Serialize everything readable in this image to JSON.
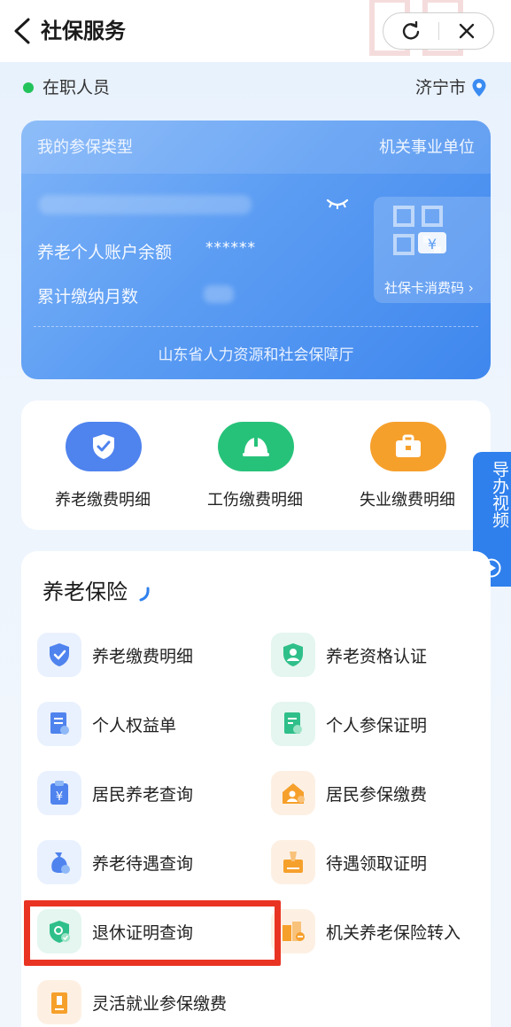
{
  "nav": {
    "title": "社保服务",
    "back_icon": "back-icon",
    "refresh_icon": "refresh-icon",
    "close_icon": "close-icon"
  },
  "status": {
    "employment": "在职人员",
    "city": "济宁市"
  },
  "card": {
    "type_label": "我的参保类型",
    "type_value": "机关事业单位",
    "balance_label": "养老个人账户余额",
    "balance_value": "******",
    "months_label": "累计缴纳月数",
    "qr_label": "社保卡消费码 ›",
    "footer": "山东省人力资源和社会保障厅",
    "colors": {
      "card_start": "#7fb4f8",
      "card_end": "#3f87ee"
    }
  },
  "quick": [
    {
      "label": "养老缴费明细",
      "icon": "shield-icon",
      "color": "#4f83ee"
    },
    {
      "label": "工伤缴费明细",
      "icon": "helmet-icon",
      "color": "#27c27a"
    },
    {
      "label": "失业缴费明细",
      "icon": "briefcase-icon",
      "color": "#f6a02c"
    }
  ],
  "side_tab": {
    "label": "导办视频",
    "icon": "play-icon"
  },
  "pension": {
    "title": "养老保险",
    "items": [
      {
        "label": "养老缴费明细",
        "icon": "shield-check-icon",
        "tone": "blue"
      },
      {
        "label": "养老资格认证",
        "icon": "user-verify-icon",
        "tone": "green"
      },
      {
        "label": "个人权益单",
        "icon": "document-icon",
        "tone": "blue"
      },
      {
        "label": "个人参保证明",
        "icon": "certificate-icon",
        "tone": "green"
      },
      {
        "label": "居民养老查询",
        "icon": "yuan-clipboard-icon",
        "tone": "blue"
      },
      {
        "label": "居民参保缴费",
        "icon": "house-user-icon",
        "tone": "orange"
      },
      {
        "label": "养老待遇查询",
        "icon": "money-bag-icon",
        "tone": "blue"
      },
      {
        "label": "待遇领取证明",
        "icon": "sign-document-icon",
        "tone": "orange"
      },
      {
        "label": "退休证明查询",
        "icon": "retire-check-icon",
        "tone": "green"
      },
      {
        "label": "机关养老保险转入",
        "icon": "building-transfer-icon",
        "tone": "orange"
      },
      {
        "label": "灵活就业参保缴费",
        "icon": "id-badge-icon",
        "tone": "orange"
      }
    ]
  },
  "highlight": {
    "target": "退休证明查询",
    "color": "#e93423"
  }
}
